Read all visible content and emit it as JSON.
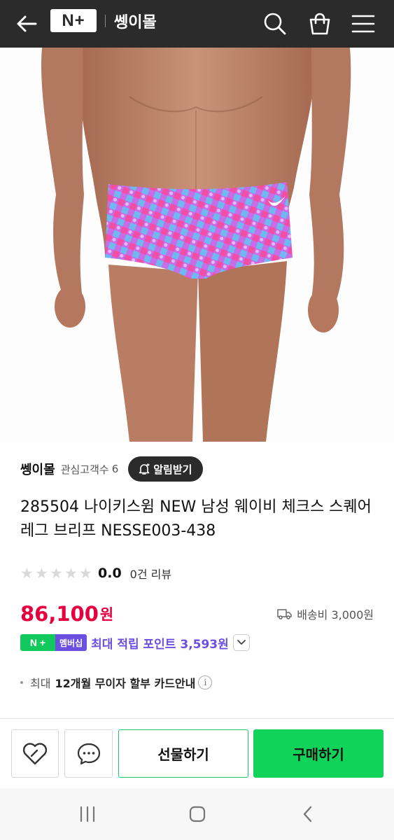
{
  "header": {
    "logo_text": "N+",
    "store_title": "쎙이몰",
    "icons": [
      "back-arrow-icon",
      "search-icon",
      "bag-icon",
      "menu-icon"
    ]
  },
  "store": {
    "name": "쎙이몰",
    "fans_label": "관심고객수",
    "fans_count": "6",
    "alarm_label": "알림받기"
  },
  "product": {
    "title": "285504 나이키스윔 NEW 남성 웨이비 체크스 스퀘어 레그 브리프 NESSE003-438",
    "rating": "0.0",
    "rating_stars": 0,
    "review_text": "0건 리뷰",
    "price": "86,100",
    "price_unit": "원",
    "shipping": "배송비 3,000원"
  },
  "membership": {
    "badge_n": "N +",
    "badge_label": "멤버십",
    "text": "최대 적립 포인트 3,593원"
  },
  "installment": {
    "prefix": "최대",
    "bold": "12개월 무이자 할부 카드안내",
    "info": "i"
  },
  "actions": {
    "gift_label": "선물하기",
    "buy_label": "구매하기"
  },
  "colors": {
    "header_bg": "#2b2b2b",
    "price": "#e6003e",
    "membership": "#6b4fe0",
    "buy_button": "#12d35a",
    "gift_border": "#1ec767"
  }
}
